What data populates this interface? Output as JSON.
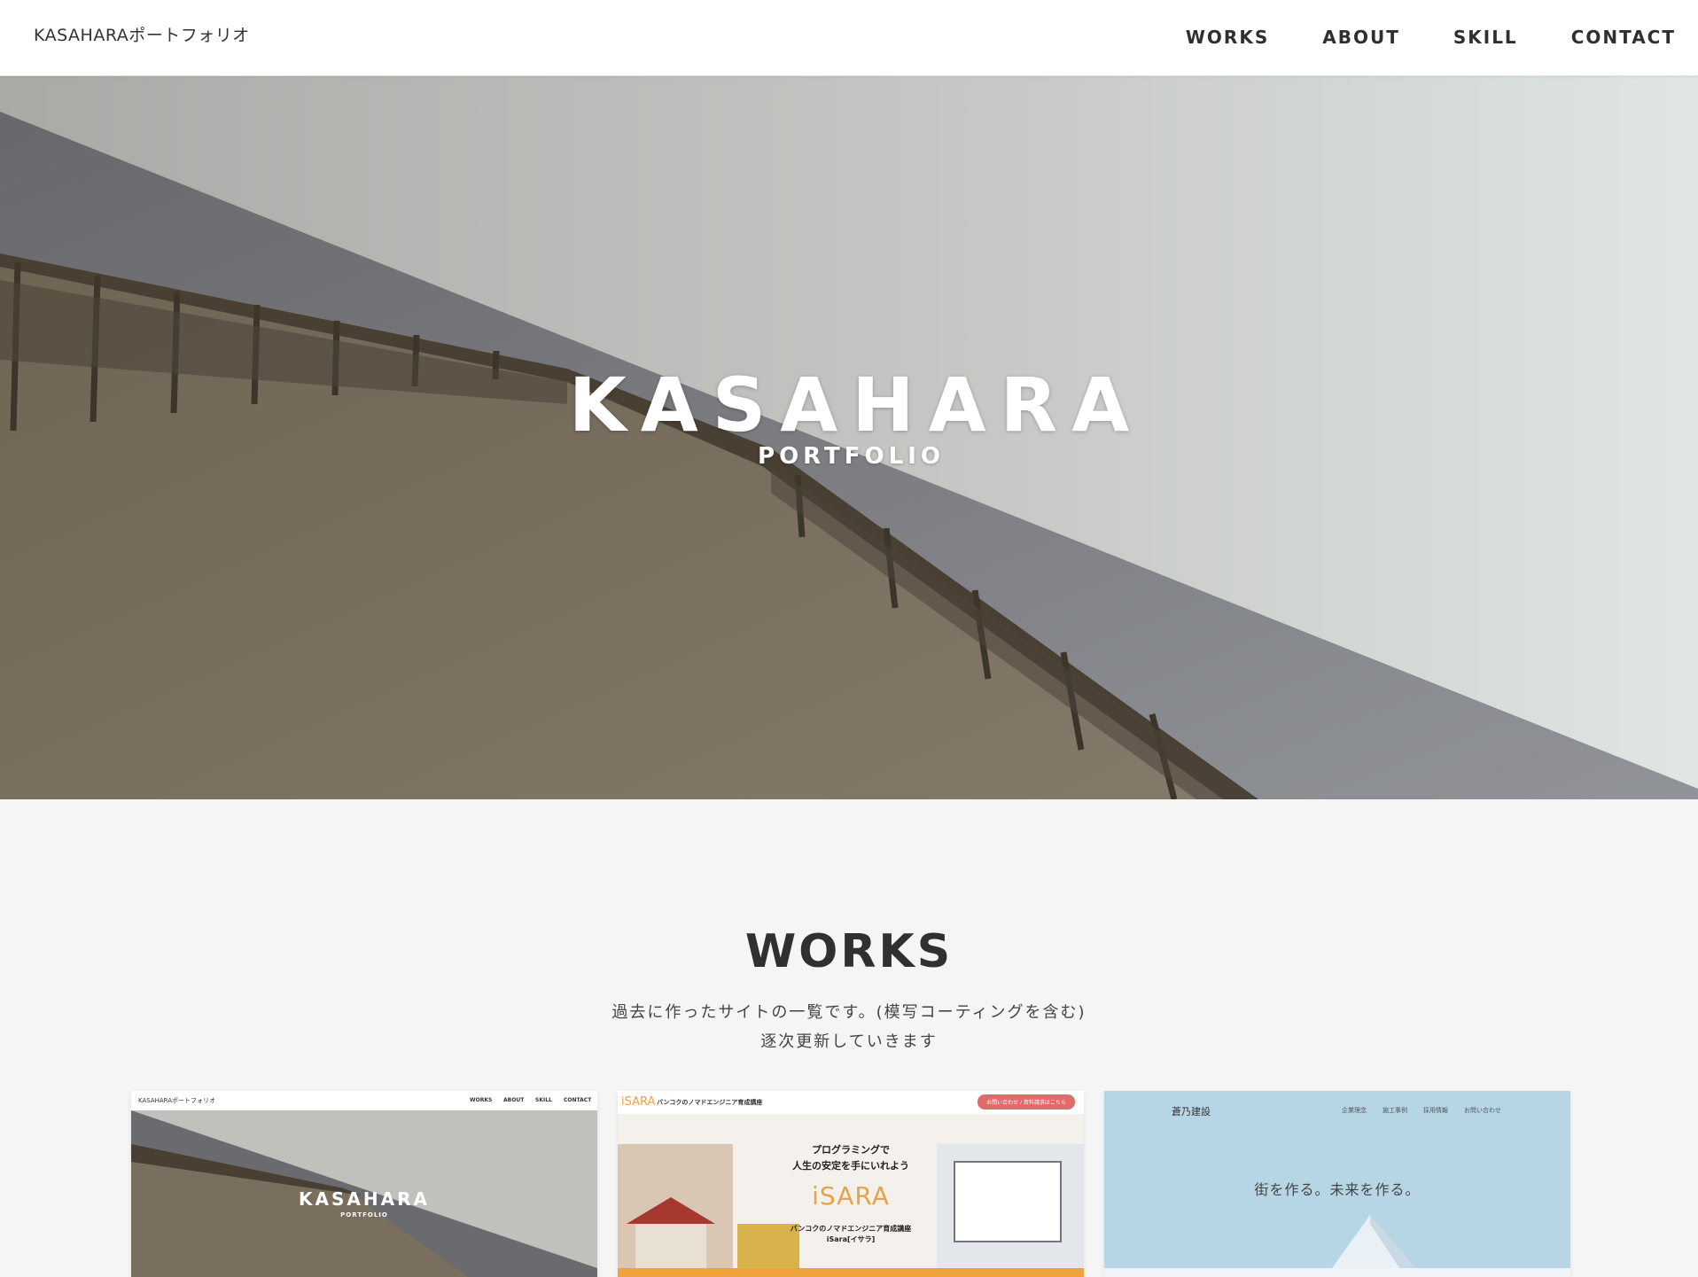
{
  "header": {
    "logo": "KASAHARAポートフォリオ",
    "nav": [
      "WORKS",
      "ABOUT",
      "SKILL",
      "CONTACT"
    ]
  },
  "hero": {
    "title": "KASAHARA",
    "subtitle": "PORTFOLIO"
  },
  "works": {
    "title": "WORKS",
    "desc_line1": "過去に作ったサイトの一覧です。(模写コーティングを含む)",
    "desc_line2": "逐次更新していきます",
    "cards": [
      {
        "logo": "KASAHARAポートフォリオ",
        "nav": [
          "WORKS",
          "ABOUT",
          "SKILL",
          "CONTACT"
        ],
        "title": "KASAHARA",
        "subtitle": "PORTFOLIO"
      },
      {
        "logo": "iSARA",
        "heading": "バンコクのノマドエンジニア育成講座",
        "cta": "お問い合わせ / 資料請求はこちら",
        "copy_line1": "プログラミングで",
        "copy_line2": "人生の安定を手にいれよう",
        "brand": "iSARA",
        "caption_line1": "バンコクのノマドエンジニア育成講座",
        "caption_line2": "iSara[イサラ]"
      },
      {
        "logo": "蒼乃建設",
        "nav": [
          "企業理念",
          "施工事例",
          "採用情報",
          "お問い合わせ"
        ],
        "tagline": "街を作る。未来を作る。"
      }
    ]
  },
  "colors": {
    "accent_red": "#e36a6a",
    "isara_orange": "#f0a23a",
    "sky_blue": "#b6d6e6"
  }
}
